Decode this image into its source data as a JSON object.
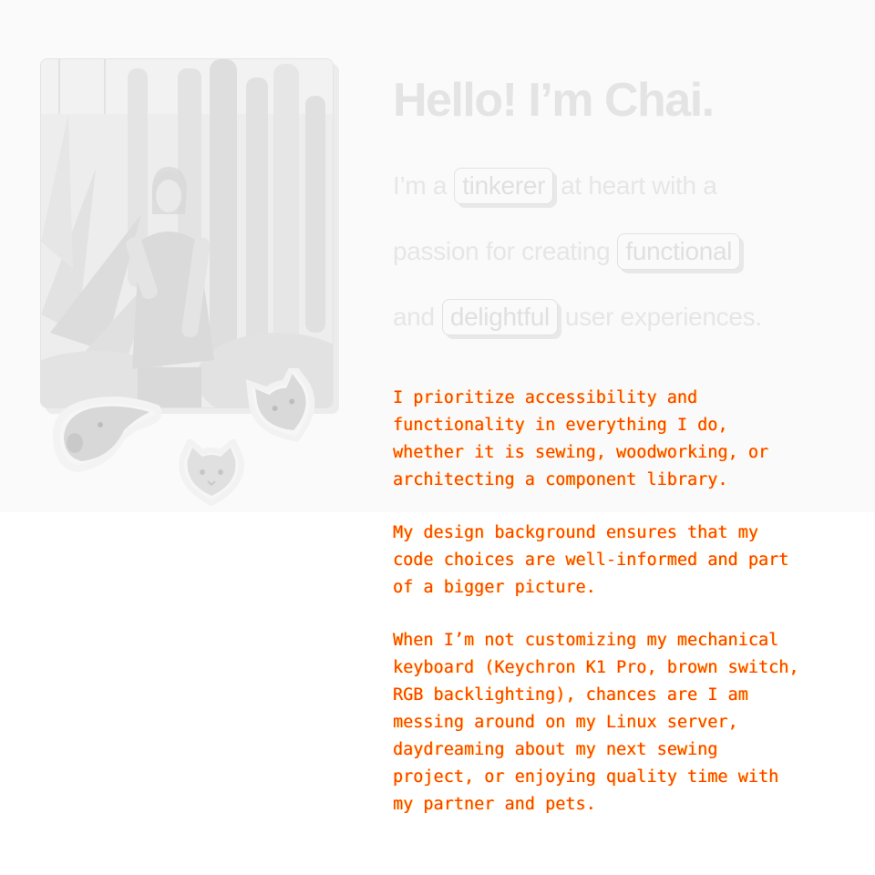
{
  "hero": {
    "greeting": "Hello! I’m Chai."
  },
  "intro": {
    "line1_prefix": "I’m a",
    "chip1": "tinkerer",
    "line1_suffix": "at heart with a",
    "line2_prefix": "passion for creating",
    "chip2": "functional",
    "line3_prefix": "and",
    "chip3": "delightful",
    "line3_suffix": "user experiences."
  },
  "about": {
    "paragraphs": [
      "I prioritize accessibility and\nfunctionality in everything I do,\nwhether it is sewing, woodworking, or\narchitecting a component library.",
      "My design background ensures that my\ncode choices are well-informed and part\nof a bigger picture.",
      "When I’m not customizing my mechanical\nkeyboard (Keychron K1 Pro, brown switch,\nRGB backlighting), chances are I am\nmessing around on my Linux server,\ndaydreaming about my next sewing\nproject, or enjoying quality time with\nmy partner and pets."
    ]
  },
  "colors": {
    "body_text": "#ff3b00",
    "body_text_glow": "#ffd400",
    "band_background": "#fafafa",
    "muted_text": "#e4e4e4"
  },
  "icons": {
    "dog_sticker": "dog-sticker-icon",
    "cat_sticker_left": "cat-sticker-icon",
    "cat_sticker_right": "cat-sticker-icon"
  }
}
